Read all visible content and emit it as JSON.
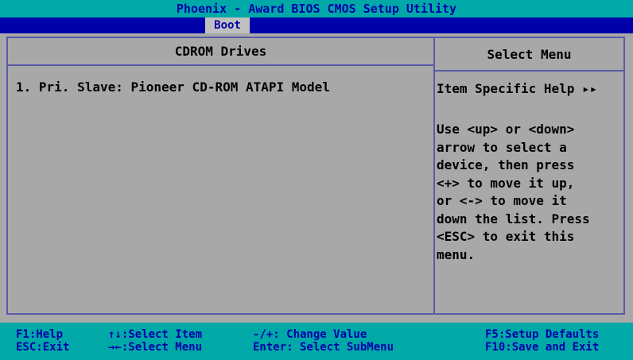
{
  "title": "Phoenix - Award BIOS CMOS Setup Utility",
  "active_tab": "Boot",
  "left_panel": {
    "header": "CDROM Drives",
    "items": [
      "1. Pri. Slave: Pioneer CD-ROM ATAPI Model"
    ]
  },
  "right_panel": {
    "header": "Select Menu",
    "help_title": "Item Specific Help ▸▸",
    "help_text": "Use <up> or <down>\narrow to select a\ndevice, then press\n<+> to move it up,\nor <-> to move it\ndown the list. Press\n<ESC> to exit this\nmenu."
  },
  "footer": {
    "f1": "F1:Help",
    "esc": "ESC:Exit",
    "select_item": "↑↓:Select Item",
    "select_menu": "→←:Select Menu",
    "change_value": "-/+: Change Value",
    "enter": "Enter: Select SubMenu",
    "f5": "F5:Setup Defaults",
    "f10": "F10:Save and Exit"
  },
  "colors": {
    "bios_blue": "#0000a8",
    "bios_cyan": "#00a8a8",
    "panel_gray": "#a8a8a8",
    "frame_line": "#5a5aa8"
  }
}
